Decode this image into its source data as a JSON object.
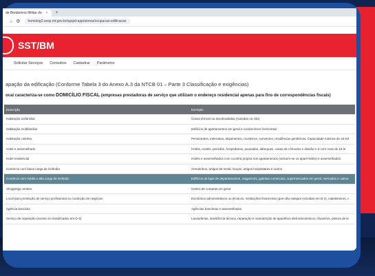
{
  "browser": {
    "tab_title": "de Bombeiros Militar do",
    "tab_close": "×",
    "new_tab": "+",
    "url": "homolog2.sesp.mt.gov.br/sgspd-app/atvora/ocupacao-edificacao"
  },
  "header": {
    "brand": "SST/BM"
  },
  "nav": [
    "Solicitar Serviços",
    "Consultos",
    "Cadastrar",
    "Parâmetro"
  ],
  "page": {
    "title": "apação da edificação (Conforme Tabela 3 do Anexo A.3 da NTCB 01 – Parte 3 Classificação e exigências)",
    "notice_prefix": "ocal caracteriza-se como ",
    "notice_em": "DOMICÍLIO FISCAL",
    "notice_suffix": " (empresas prestadoras de serviço que utilizam o endereço residencial apenas para fins de correspondências fiscais)"
  },
  "table": {
    "headers": [
      "Descrição",
      "Exemplo"
    ],
    "rows": [
      [
        "Habitação unifamiliar",
        "Casas térreas ou assobradadas (isoladas ou não)"
      ],
      [
        "Habitação multifamiliar",
        "Edifícios de apartamentos em geral e condomínios horizontais"
      ],
      [
        "Habitação coletiva",
        "Pensionatos, internatos, alojamentos, mosteiros, conventos, residências geriátricas. Capacidade máxima de 16 leit"
      ],
      [
        "Hotel e assemelhado",
        "Hotéis, motéis, pensões, hospedarias, pousadas, albergues, casas de cômodos e divisão A-3 com mais de 16 le"
      ],
      [
        "Hotel residencial",
        "Hotéis e assemelhados com cozinha própria nos apartamentos (incluem-se os apart-hotéis) e assemelhados."
      ],
      [
        "Comércio com baixa carga de incêndio",
        "Armarinhos, artigos de metal, louças, artigos hospitalares e outros"
      ],
      [
        "Comércio com média e alta carga de incêndio",
        "Edifícios de lojas de departamentos, magazines, galerias comerciais, supermercados em geral, mercados e outros"
      ],
      [
        "Shoppings centers",
        "Centro de compras em geral"
      ],
      [
        "Local para prestação de serviço profissional ou condução de negócios",
        "Escritórios administrativos ou técnicos, instituições financeiras (que não estejam incluídas em D-2), cabeleireiros, c"
      ],
      [
        "Agência bancária",
        "Agências bancárias e assemelhados"
      ],
      [
        "Serviço de reparação (exceto os classificados em G-4)",
        "Lavanderias, assistência técnica, reparação e manutenção de aparelhos eletrodomésticos, chaveiros, pintura de le"
      ]
    ],
    "highlighted_row": 6
  }
}
